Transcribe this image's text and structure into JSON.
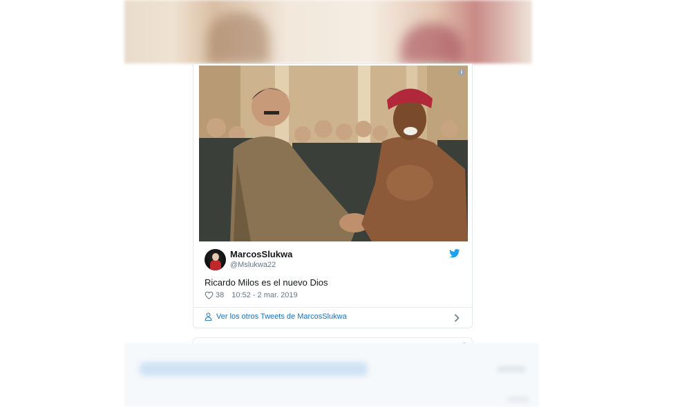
{
  "tweet": {
    "display_name": "MarcosSlukwa",
    "handle": "@Mslukwa22",
    "text": "Ricardo Milos es el nuevo Dios",
    "likes": "38",
    "timestamp": "10:52 - 2 mar. 2019",
    "more_tweets_link": "Ver los otros Tweets de MarcosSlukwa",
    "info_icon_glyph": "i"
  },
  "icons": {
    "brand": "twitter-bird-icon",
    "like": "heart-icon",
    "profile": "person-icon",
    "navigate": "chevron-right-icon",
    "info": "info-icon"
  },
  "colors": {
    "brand_blue": "#1da1f2",
    "link_blue": "#1b6fb1",
    "text_primary": "#14171a",
    "text_secondary": "#657786",
    "border": "#e1e8ed"
  }
}
